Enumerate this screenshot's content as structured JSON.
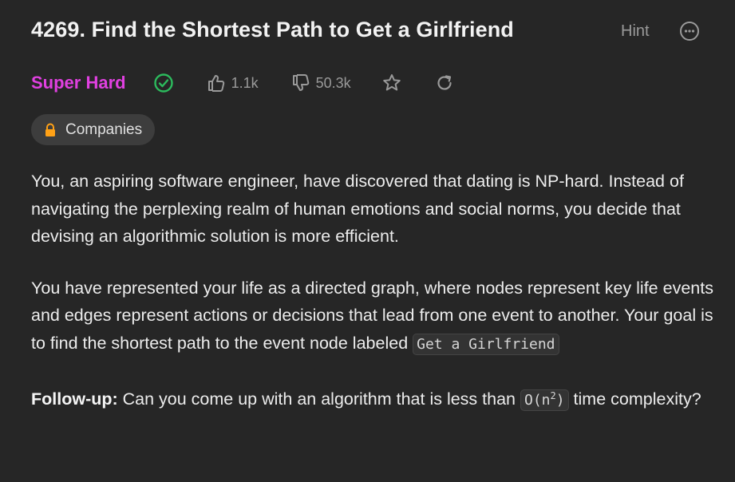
{
  "problem": {
    "title": "4269. Find the Shortest Path to Get a Girlfriend",
    "hint_label": "Hint",
    "difficulty": "Super Hard",
    "likes": "1.1k",
    "dislikes": "50.3k",
    "tag_label": "Companies"
  },
  "description": {
    "para1": "You, an aspiring software engineer, have discovered that dating is NP-hard. Instead of navigating the perplexing realm of human emotions and social norms, you decide that devising an algorithmic solution is more efficient.",
    "para2_text": "You have represented your life as a directed graph, where nodes represent key life events and edges represent actions or decisions that lead from one event to another. Your goal is to find the shortest path to the event node labeled ",
    "para2_code": "Get a Girlfriend",
    "followup_label": "Follow-up:",
    "followup_text_before": " Can you come up with an algorithm that is less than ",
    "followup_code_base": "O(n",
    "followup_code_exp": "2",
    "followup_code_close": ")",
    "followup_text_after": " time complexity?"
  },
  "colors": {
    "background": "#262626",
    "difficulty": "#e040e0",
    "solved": "#2cbb5d",
    "muted": "#9a9a9a",
    "lock": "#ffa116"
  },
  "icons": [
    "more-icon",
    "check-circle-icon",
    "thumbs-up-icon",
    "thumbs-down-icon",
    "star-icon",
    "share-icon",
    "lock-icon"
  ]
}
